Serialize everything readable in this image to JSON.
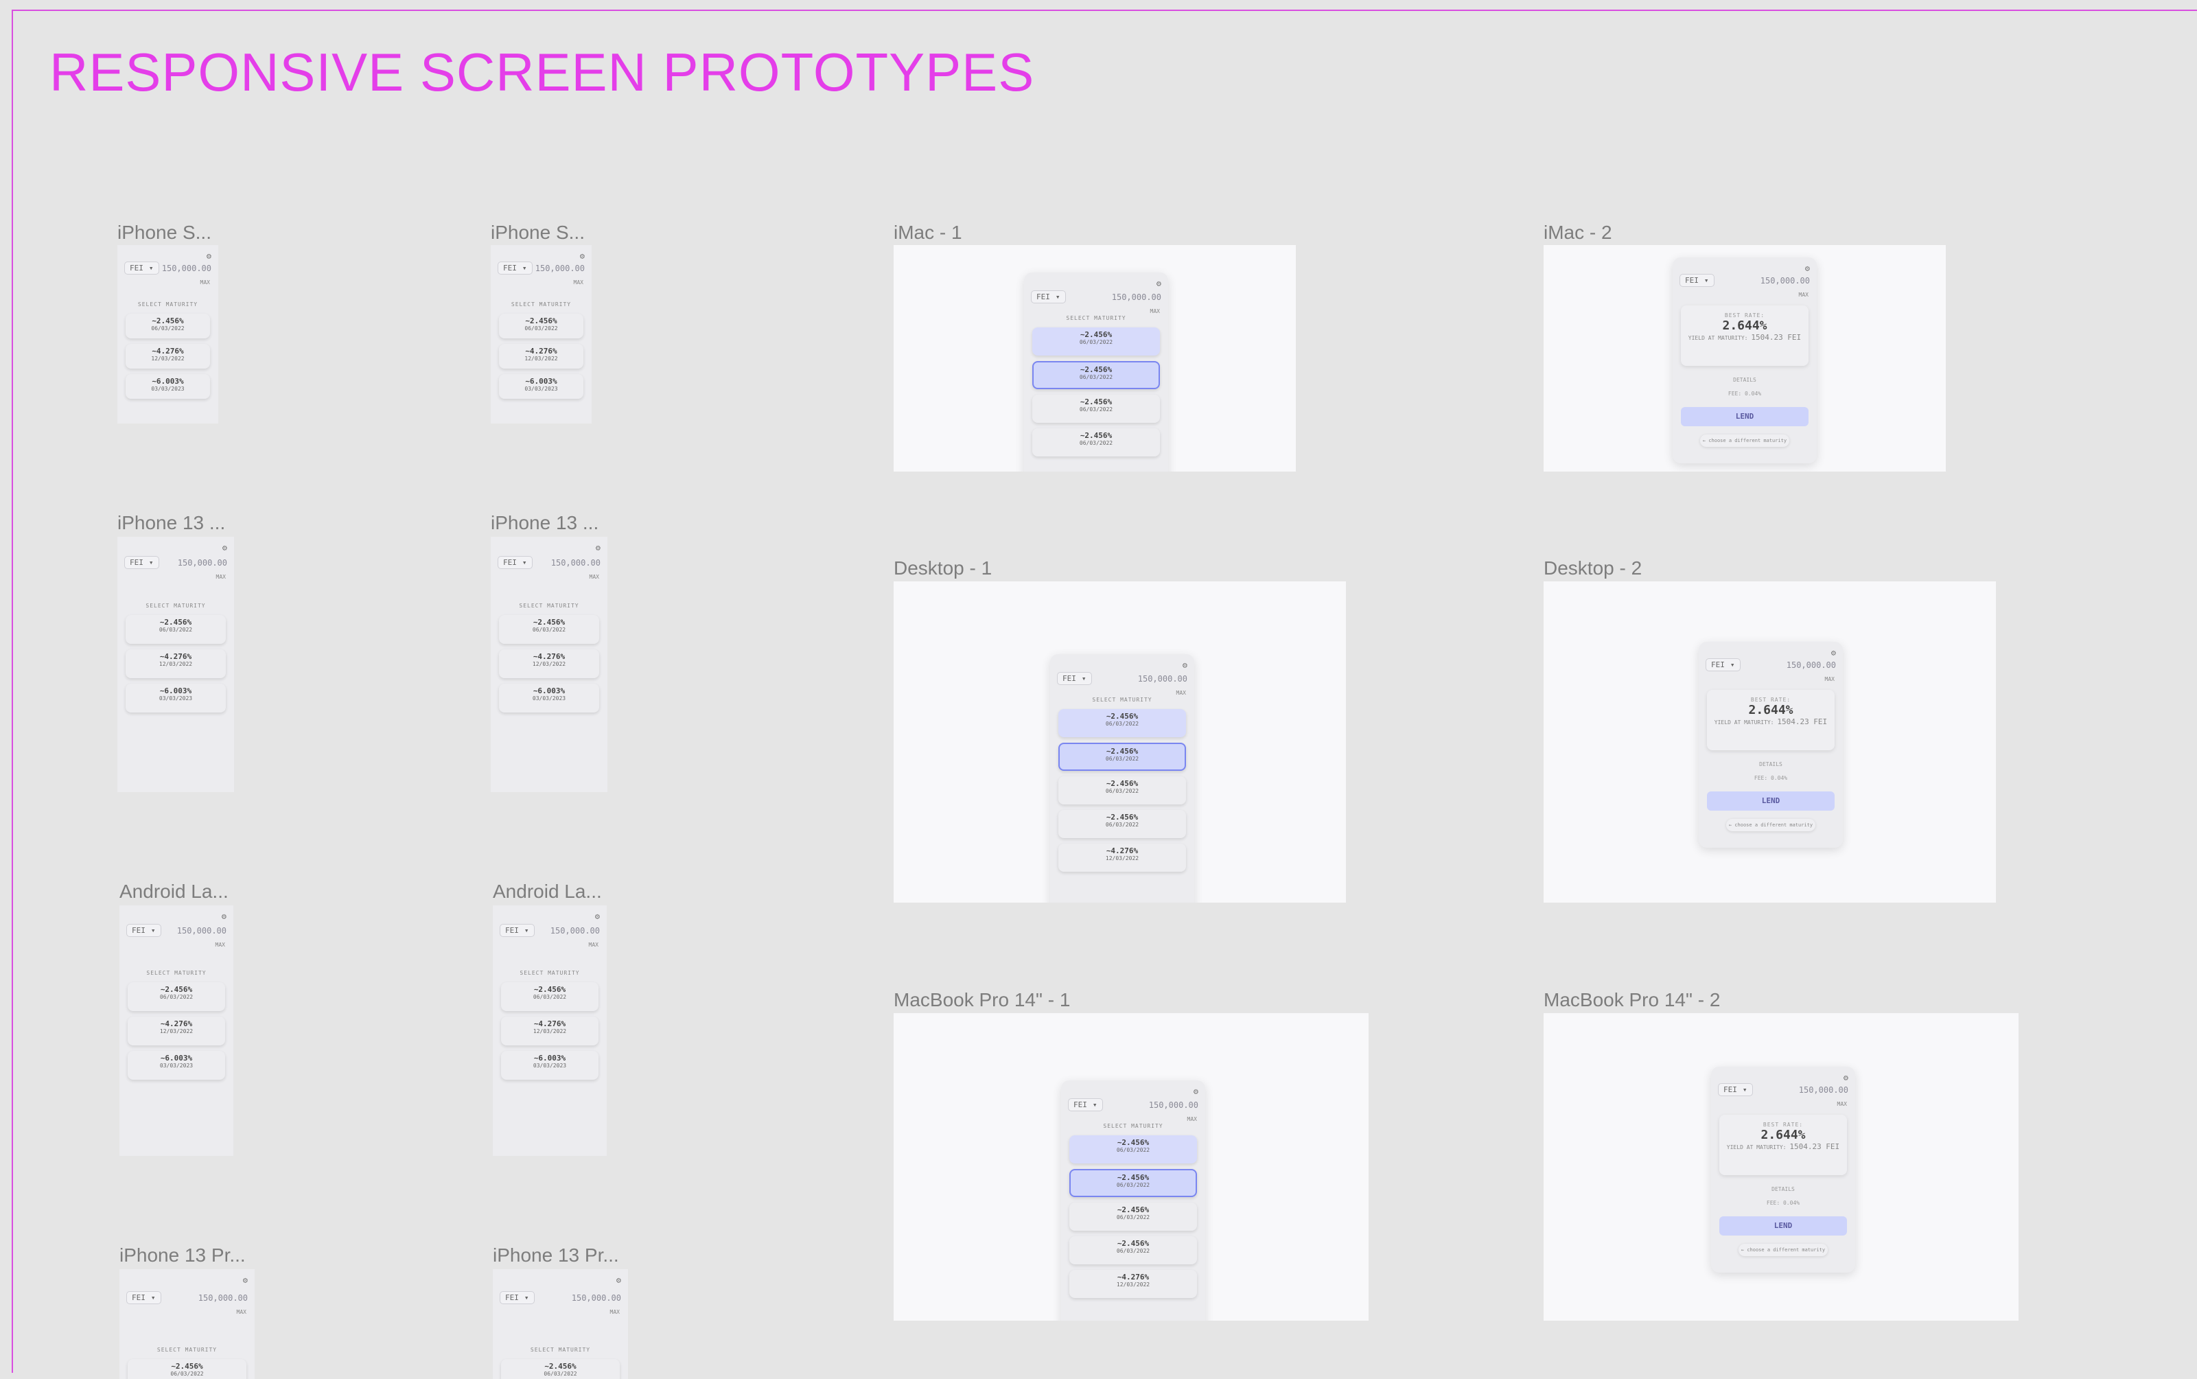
{
  "page_title": "RESPONSIVE SCREEN PROTOTYPES",
  "frames": [
    {
      "label": "iPhone S..."
    },
    {
      "label": "iPhone S..."
    },
    {
      "label": "iMac - 1"
    },
    {
      "label": "iMac - 2"
    },
    {
      "label": "iPhone 13 ..."
    },
    {
      "label": "iPhone 13 ..."
    },
    {
      "label": "Desktop - 1"
    },
    {
      "label": "Desktop - 2"
    },
    {
      "label": "Android La..."
    },
    {
      "label": "Android La..."
    },
    {
      "label": "MacBook Pro 14\" - 1"
    },
    {
      "label": "MacBook Pro 14\" - 2"
    },
    {
      "label": "iPhone 13 Pr..."
    },
    {
      "label": "iPhone 13 Pr..."
    }
  ],
  "widget": {
    "token": "FEI",
    "token_caret": "▾",
    "amount": "150,000.00",
    "max_label": "MAX",
    "select_maturity": "SELECT MATURITY",
    "gear_icon": "gear-icon",
    "options_a": [
      {
        "rate": "~2.456%",
        "date": "06/03/2022"
      },
      {
        "rate": "~4.276%",
        "date": "12/03/2022"
      },
      {
        "rate": "~6.003%",
        "date": "03/03/2023"
      }
    ],
    "options_b": [
      {
        "rate": "~2.456%",
        "date": "06/03/2022"
      },
      {
        "rate": "~2.456%",
        "date": "06/03/2022"
      },
      {
        "rate": "~2.456%",
        "date": "06/03/2022"
      },
      {
        "rate": "~2.456%",
        "date": "06/03/2022"
      },
      {
        "rate": "~4.276%",
        "date": "12/03/2022"
      }
    ],
    "best_rate_label": "BEST RATE:",
    "best_rate": "2.644%",
    "yield_label": "YIELD AT MATURITY:",
    "yield_value": "1504.23 FEI",
    "details": "DETAILS",
    "fee": "FEE: 0.04%",
    "lend": "LEND",
    "choose": "← choose a different maturity"
  },
  "colors": {
    "title": "#e43ee9",
    "highlight": "#d7dbfb",
    "selected_border": "#7a86f0"
  }
}
